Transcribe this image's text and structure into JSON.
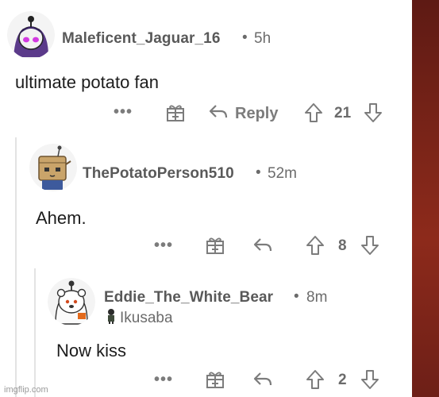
{
  "comments": [
    {
      "username": "Maleficent_Jaguar_16",
      "separator": "•",
      "time": "5h",
      "body": "ultimate potato fan",
      "more_label": "•••",
      "reply_label": "Reply",
      "votes": "21"
    },
    {
      "username": "ThePotatoPerson510",
      "separator": "•",
      "time": "52m",
      "body": "Ahem.",
      "more_label": "•••",
      "votes": "8"
    },
    {
      "username": "Eddie_The_White_Bear",
      "separator": "•",
      "time": "8m",
      "flair": "Ikusaba",
      "body": "Now kiss",
      "more_label": "•••",
      "votes": "2"
    }
  ],
  "watermark": "imgflip.com",
  "colors": {
    "text": "#1c1c1c",
    "meta": "#6b6b6b",
    "icon": "#7c7c7c",
    "side_strip": "#7a2418"
  },
  "icons": [
    "award-icon",
    "reply-arrow-icon",
    "upvote-icon",
    "downvote-icon"
  ]
}
